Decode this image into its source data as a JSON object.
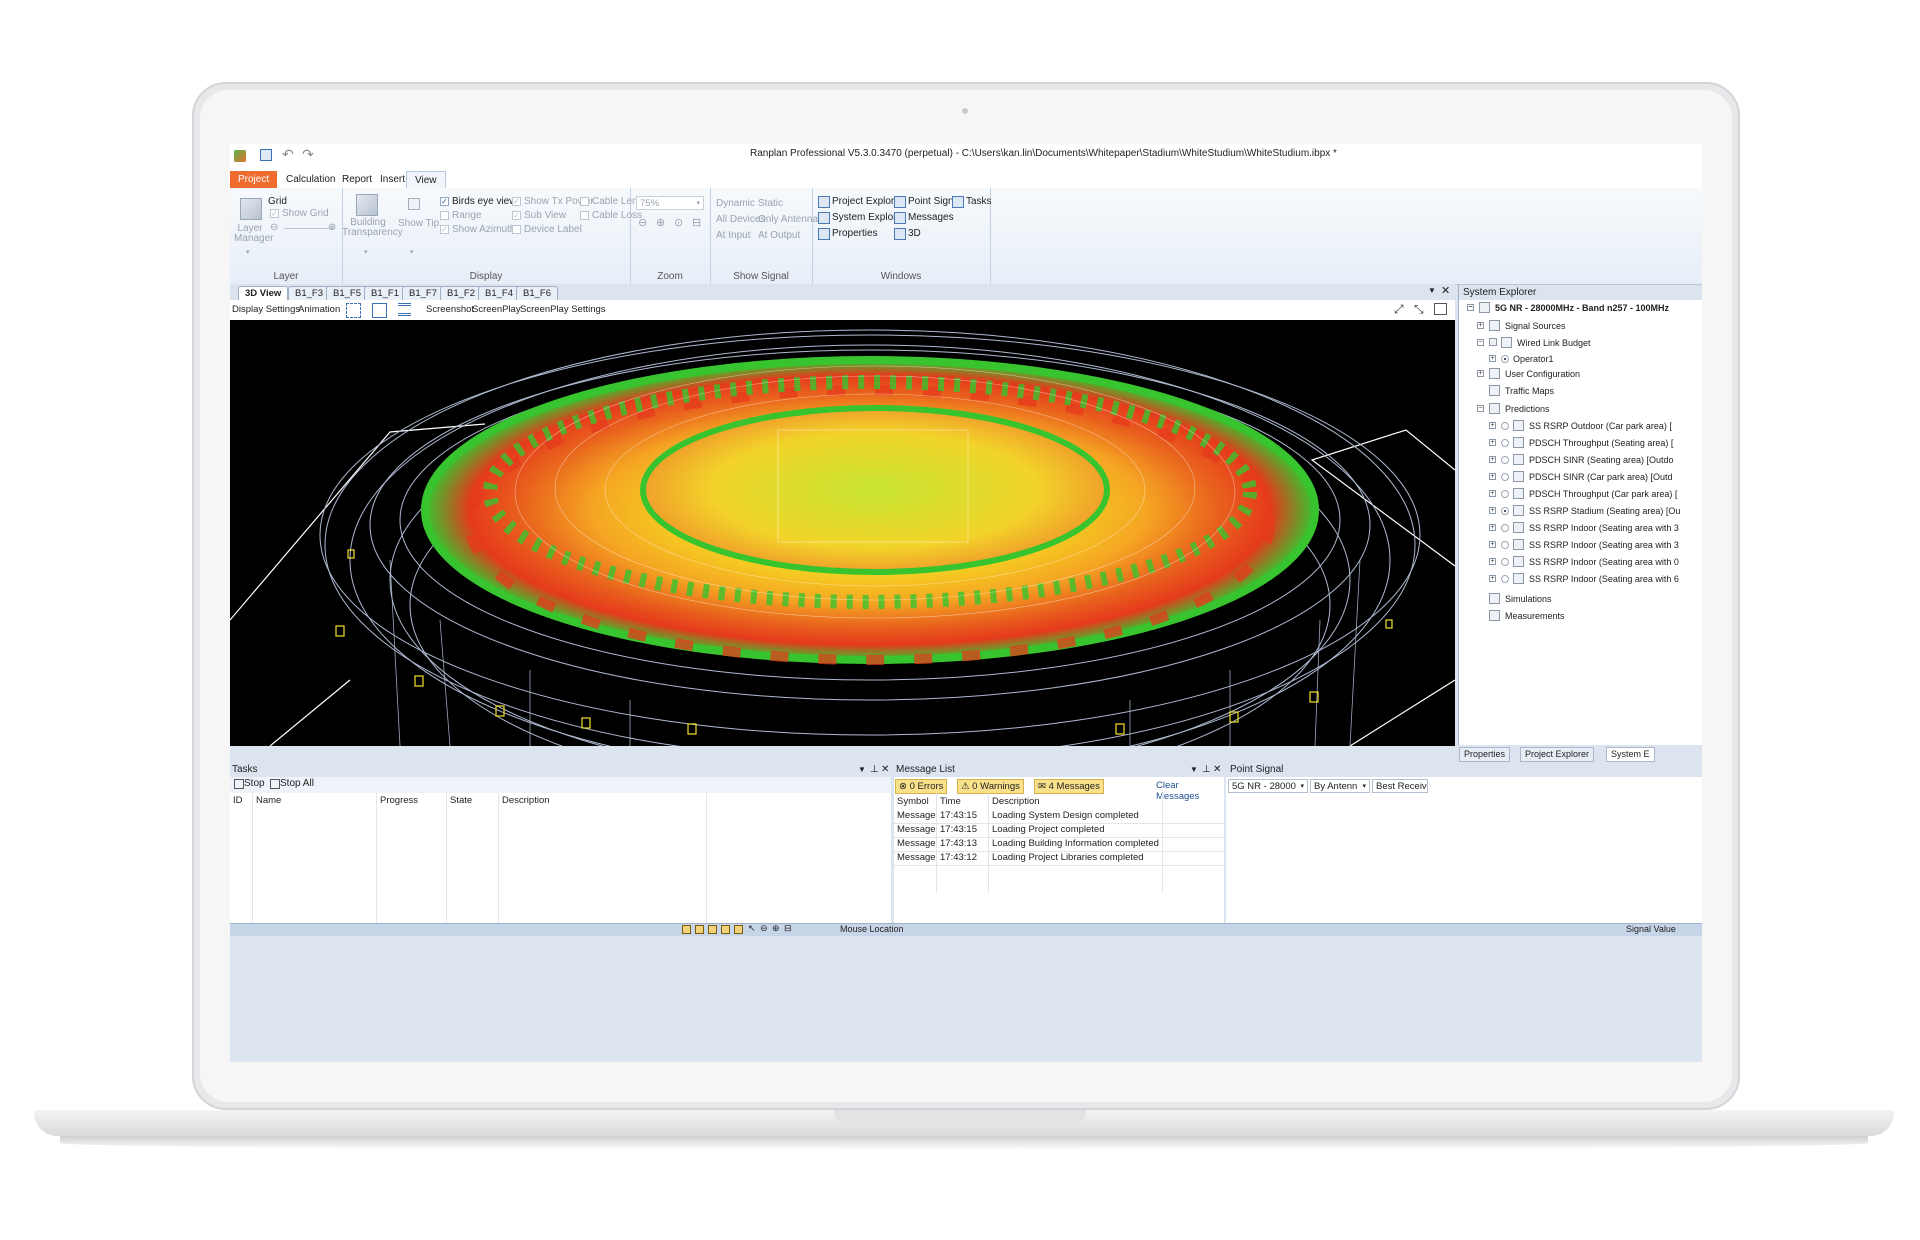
{
  "window": {
    "title": "Ranplan Professional V5.3.0.3470 (perpetual) - C:\\Users\\kan.lin\\Documents\\Whitepaper\\Stadium\\WhiteStudium\\WhiteStudium.ibpx *"
  },
  "ribbon_tabs": [
    "Project",
    "Calculation",
    "Report",
    "Insert",
    "View"
  ],
  "ribbon": {
    "layer": {
      "grid_label": "Grid",
      "show_grid": "Show Grid",
      "layer_manager": "Layer Manager",
      "group": "Layer"
    },
    "display": {
      "building_transparency": "Building Transparency",
      "show_tip": "Show Tip",
      "birds_eye_view": "Birds eye view",
      "range": "Range",
      "show_azimuth": "Show Azimuth",
      "show_tx_power": "Show Tx Power",
      "sub_view": "Sub View",
      "device_label": "Device Label",
      "cable_length": "Cable Length",
      "cable_loss": "Cable Loss",
      "group": "Display"
    },
    "zoom": {
      "value": "75%",
      "group": "Zoom"
    },
    "show_signal": {
      "dynamic": "Dynamic",
      "static": "Static",
      "all_devices": "All Devices",
      "only_antenna": "Only Antenna",
      "at_input": "At Input",
      "at_output": "At Output",
      "group": "Show Signal"
    },
    "windows": {
      "project_explorer": "Project Explorer",
      "point_signal": "Point Signal",
      "tasks": "Tasks",
      "system_explorer": "System Explorer",
      "messages": "Messages",
      "properties": "Properties",
      "three_d": "3D",
      "group": "Windows"
    }
  },
  "doc_tabs": [
    "3D View",
    "B1_F3",
    "B1_F5",
    "B1_F1",
    "B1_F7",
    "B1_F2",
    "B1_F4",
    "B1_F6"
  ],
  "view_toolbar": {
    "display_settings": "Display Settings",
    "animation": "Animation",
    "screenshot": "Screenshot",
    "screenplay": "ScreenPlay",
    "screenplay_settings": "ScreenPlay Settings"
  },
  "system_explorer": {
    "title": "System Explorer",
    "root": "5G NR - 28000MHz - Band n257 - 100MHz",
    "signal_sources": "Signal Sources",
    "wired_link_budget": "Wired Link Budget",
    "operator": "Operator1",
    "user_configuration": "User Configuration",
    "traffic_maps": "Traffic Maps",
    "predictions": "Predictions",
    "prediction_items": [
      "SS RSRP Outdoor (Car park area) [",
      "PDSCH Throughput (Seating area) [",
      "PDSCH SINR (Seating area) [Outdo",
      "PDSCH SINR (Car park area) [Outd",
      "PDSCH Throughput (Car park area) [",
      "SS RSRP Stadium (Seating area) [Ou",
      "SS RSRP Indoor (Seating area with 3",
      "SS RSRP Indoor (Seating area with 3",
      "SS RSRP Indoor (Seating area with 0",
      "SS RSRP Indoor (Seating area with 6"
    ],
    "selected_prediction_index": 5,
    "simulations": "Simulations",
    "measurements": "Measurements"
  },
  "side_tabs": [
    "Properties",
    "Project Explorer",
    "System E"
  ],
  "tasks": {
    "title": "Tasks",
    "stop": "Stop",
    "stop_all": "Stop All",
    "columns": [
      "ID",
      "Name",
      "Progress",
      "State",
      "Description"
    ]
  },
  "messages": {
    "title": "Message List",
    "errors": "0 Errors",
    "warnings": "0 Warnings",
    "msgs": "4 Messages",
    "clear": "Clear Messages",
    "columns": [
      "Symbol",
      "Time",
      "Description"
    ],
    "rows": [
      {
        "symbol": "Message",
        "time": "17:43:15",
        "description": "Loading System Design completed"
      },
      {
        "symbol": "Message",
        "time": "17:43:15",
        "description": "Loading Project completed"
      },
      {
        "symbol": "Message",
        "time": "17:43:13",
        "description": "Loading Building Information completed"
      },
      {
        "symbol": "Message",
        "time": "17:43:12",
        "description": "Loading Project Libraries completed"
      }
    ]
  },
  "point_signal": {
    "title": "Point Signal",
    "technology": "5G NR - 28000",
    "mode": "By Antenn",
    "measure": "Best Receive"
  },
  "status": {
    "mouse_location": "Mouse Location",
    "signal_value": "Signal Value"
  },
  "colors": {
    "accent": "#f06b2e",
    "panel": "#dbe4ef",
    "heatmap_high": "#e53a1c",
    "heatmap_mid": "#f5d521",
    "heatmap_low": "#37c42e"
  }
}
